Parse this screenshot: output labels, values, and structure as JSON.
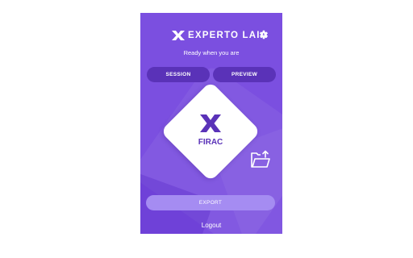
{
  "app": {
    "brand": "EXPERTO LAIA",
    "tagline": "Ready when you are",
    "colors": {
      "panel_bg": "#7b4fe0",
      "tab_bg": "#5a32b8",
      "export_bg": "#a58cf2",
      "card_bg": "#ffffff",
      "accent": "#5a32b8"
    }
  },
  "header": {
    "logo_icon": "x-logo-icon",
    "settings_icon": "gear-icon"
  },
  "tabs": [
    {
      "label": "SESSION"
    },
    {
      "label": "PREVIEW"
    }
  ],
  "card": {
    "icon": "x-logo-icon",
    "label": "FIRAC"
  },
  "folder": {
    "icon": "folder-upload-icon"
  },
  "actions": {
    "export_label": "EXPORT",
    "logout_label": "Logout"
  }
}
